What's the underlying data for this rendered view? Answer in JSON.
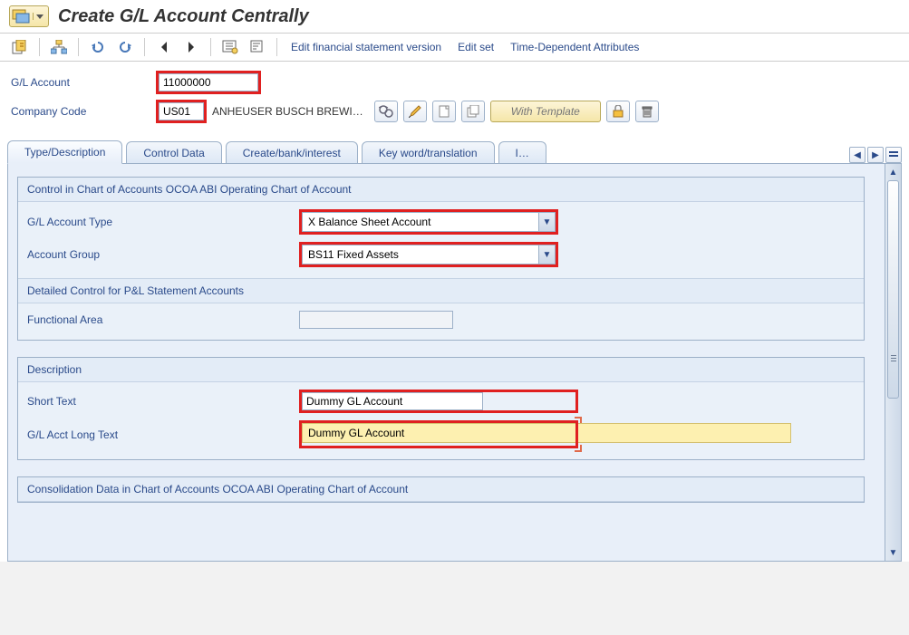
{
  "header": {
    "title": "Create G/L Account Centrally"
  },
  "menu": {
    "edit_fin": "Edit financial statement version",
    "edit_set": "Edit set",
    "time_dep": "Time-Dependent Attributes"
  },
  "fields": {
    "gl_account_label": "G/L Account",
    "gl_account_value": "11000000",
    "company_code_label": "Company Code",
    "company_code_value": "US01",
    "company_code_desc": "ANHEUSER BUSCH BREWI…",
    "with_template": "With Template"
  },
  "tabs": {
    "t1": "Type/Description",
    "t2": "Control Data",
    "t3": "Create/bank/interest",
    "t4": "Key word/translation",
    "t5": "I…"
  },
  "group1": {
    "title": "Control in Chart of Accounts OCOA ABI Operating Chart of Account",
    "gl_type_label": "G/L Account Type",
    "gl_type_value": "X Balance Sheet Account",
    "acct_group_label": "Account Group",
    "acct_group_value": "BS11 Fixed Assets",
    "sub_title": "Detailed Control for P&L Statement Accounts",
    "func_area_label": "Functional Area",
    "func_area_value": ""
  },
  "group2": {
    "title": "Description",
    "short_label": "Short Text",
    "short_value": "Dummy GL Account",
    "long_label": "G/L Acct Long Text",
    "long_value": "Dummy GL Account"
  },
  "group3": {
    "title": "Consolidation Data in Chart of Accounts OCOA ABI Operating Chart of Account"
  }
}
